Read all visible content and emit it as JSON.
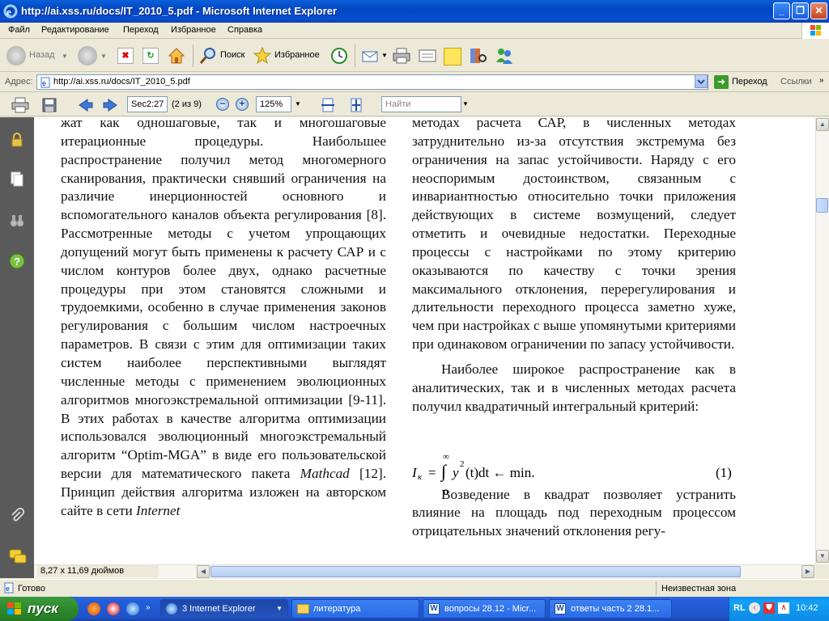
{
  "window": {
    "title": "http://ai.xss.ru/docs/IT_2010_5.pdf - Microsoft Internet Explorer",
    "minimize": "_",
    "maximize": "❐",
    "close": "✕"
  },
  "menu": [
    "Файл",
    "Редактирование",
    "Переход",
    "Избранное",
    "Справка"
  ],
  "toolbar": {
    "back": "Назад",
    "search": "Поиск",
    "favorites": "Избранное"
  },
  "address": {
    "label": "Адрес:",
    "url": "http://ai.xss.ru/docs/IT_2010_5.pdf",
    "go": "Переход",
    "links": "Ссылки"
  },
  "pdf": {
    "page_label": "Sec2:27",
    "page_count": "(2 из 9)",
    "zoom": "125%",
    "find_placeholder": "Найти"
  },
  "document": {
    "left_column": [
      "жат как одношаговые, так и многошаговые итерационные процедуры. Наибольшее распространение получил метод многомерного сканирования, практически снявший ограничения на различие инерционностей основного и вспомогательного каналов объекта регулирования [8]. Рассмотренные методы с учетом упрощающих допущений могут быть применены к расчету САР и с числом контуров более двух, однако расчетные процедуры при этом становятся сложными и трудоемкими, особенно в случае применения законов регулирования с большим числом настроечных параметров. В связи с этим для оптимизации таких систем наиболее перспективными выглядят численные методы с применением эволюционных алгоритмов многоэкстремальной оптимизации [9-11]. В этих работах в качестве алгоритма оптимизации использовался эволюционный многоэкстремальный алгоритм “Optim-MGA” в виде его пользовательской версии для математического пакета",
      "Mathcad",
      " [12]. Принцип действия алгоритма изложен на авторском сайте в сети ",
      "Internet"
    ],
    "right_column_p1": "методах расчета САР, в численных методах затруднительно из-за отсутствия экстремума без ограничения на запас устойчивости. Наряду с его неоспоримым достоинством, связанным с инвариантностью относительно точки приложения действующих в системе возмущений, следует отметить и очевидные недостатки. Переходные процессы с настройками по этому критерию оказываются по качеству с точки зрения максимального отклонения, перерегулирования и длительности переходного процесса заметно хуже, чем при настройках с выше упомянутыми критериями при одинаковом ограничении по запасу устойчивости.",
    "right_column_p2": "Наиболее широкое распространение как в аналитических, так и в численных методах расчета получил квадратичный интегральный критерий:",
    "formula": {
      "lhs": "I",
      "lhs_sub": "к",
      "upper": "∞",
      "lower": "0",
      "body": "y",
      "power": "2",
      "arg": "(t)dt ← min.",
      "number": "(1)"
    },
    "right_column_p3": "Возведение в квадрат позволяет устранить влияние на площадь под переходным процессом отрицательных значений отклонения регу-"
  },
  "page_size": "8,27 x 11,69 дюймов",
  "status": {
    "text": "Готово",
    "zone": "Неизвестная зона"
  },
  "taskbar": {
    "start": "пуск",
    "tasks": [
      "3 Internet Explorer",
      "литература",
      "вопросы 28.12 - Micr...",
      "ответы часть 2 28.1..."
    ],
    "lang": "RL",
    "clock": "10:42"
  },
  "colors": {
    "titlebar": "#0346c4",
    "taskbar": "#245edb",
    "start": "#2e8a2e"
  }
}
